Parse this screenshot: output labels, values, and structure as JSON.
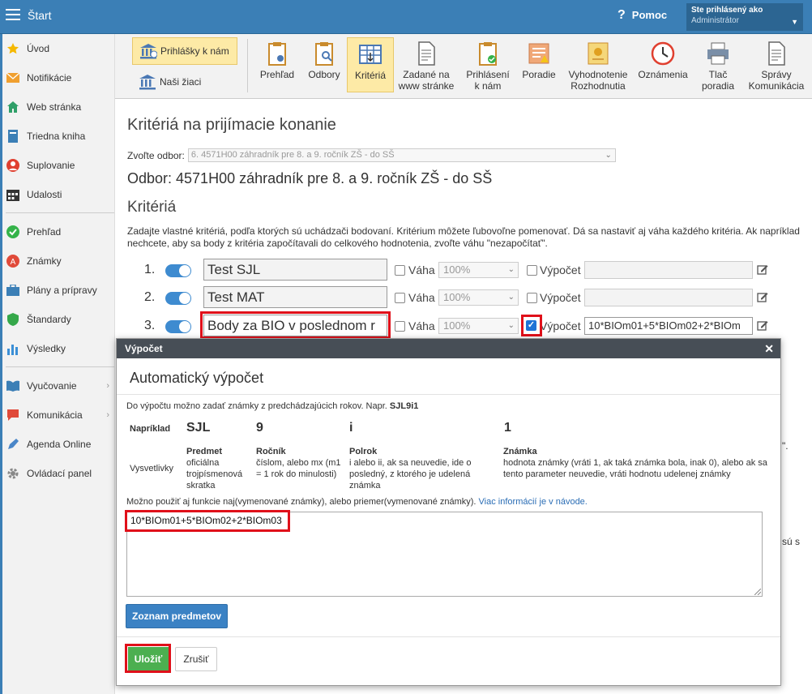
{
  "topbar": {
    "brand": "Štart",
    "help": "Pomoc",
    "user_line1": "Ste prihlásený ako",
    "user_line2": "Administrátor"
  },
  "sidebar": {
    "items": [
      {
        "label": "Úvod",
        "icon": "star-icon",
        "color": "#f5b800"
      },
      {
        "label": "Notifikácie",
        "icon": "envelope-icon",
        "color": "#f0a030"
      },
      {
        "label": "Web stránka",
        "icon": "house-icon",
        "color": "#2f9f68"
      },
      {
        "label": "Triedna kniha",
        "icon": "book-icon",
        "color": "#3b7fb6"
      },
      {
        "label": "Suplovanie",
        "icon": "person-icon",
        "color": "#e04030"
      },
      {
        "label": "Udalosti",
        "icon": "calendar-icon",
        "color": "#333333"
      },
      {
        "label": "Prehľad",
        "icon": "check-circle-icon",
        "color": "#35b34a"
      },
      {
        "label": "Známky",
        "icon": "grade-icon",
        "color": "#e04a3a"
      },
      {
        "label": "Plány a prípravy",
        "icon": "briefcase-icon",
        "color": "#3b7fb6"
      },
      {
        "label": "Štandardy",
        "icon": "shield-icon",
        "color": "#35a84a"
      },
      {
        "label": "Výsledky",
        "icon": "bar-chart-icon",
        "color": "#3b8fd6"
      },
      {
        "label": "Vyučovanie",
        "icon": "book-open-icon",
        "color": "#3b7fb6"
      },
      {
        "label": "Komunikácia",
        "icon": "chat-icon",
        "color": "#e04a3a"
      },
      {
        "label": "Agenda Online",
        "icon": "pen-icon",
        "color": "#4a86c8"
      },
      {
        "label": "Ovládací panel",
        "icon": "gear-icon",
        "color": "#888888"
      }
    ]
  },
  "toolbar": {
    "prihlasky": "Prihlášky k nám",
    "ziaci": "Naši žiaci",
    "buttons": [
      {
        "l1": "Prehľad",
        "l2": ""
      },
      {
        "l1": "Odbory",
        "l2": ""
      },
      {
        "l1": "Kritériá",
        "l2": ""
      },
      {
        "l1": "Zadané na",
        "l2": "www stránke"
      },
      {
        "l1": "Prihlásení",
        "l2": "k nám"
      },
      {
        "l1": "Poradie",
        "l2": ""
      },
      {
        "l1": "Vyhodnotenie",
        "l2": "Rozhodnutia"
      },
      {
        "l1": "Oznámenia",
        "l2": ""
      },
      {
        "l1": "Tlač",
        "l2": "poradia"
      },
      {
        "l1": "Správy",
        "l2": "Komunikácia"
      }
    ]
  },
  "main": {
    "title": "Kritériá na prijímacie konanie",
    "select_label": "Zvoľte odbor:",
    "select_value": "6. 4571H00 záhradník pre 8. a 9. ročník ZŠ - do SŠ",
    "odbor": "Odbor: 4571H00 záhradník pre 8. a 9. ročník ZŠ - do SŠ",
    "kriteria_title": "Kritériá",
    "description": "Zadajte vlastné kritériá, podľa ktorých sú uchádzači bodovaní. Kritérium môžete ľubovoľne pomenovať. Dá sa nastaviť aj váha každého kritéria. Ak napríklad nechcete, aby sa body z kritéria započítavali do celkového hodnotenia, zvoľte váhu \"nezapočítať\".",
    "vaha_label": "Váha",
    "vypocet_label": "Výpočet",
    "criteria": [
      {
        "num": "1.",
        "name": "Test SJL",
        "weight": "100%",
        "formula": "",
        "calc": false
      },
      {
        "num": "2.",
        "name": "Test MAT",
        "weight": "100%",
        "formula": "",
        "calc": false
      },
      {
        "num": "3.",
        "name": "Body za BIO v poslednom r",
        "weight": "100%",
        "formula": "10*BIOm01+5*BIOm02+2*BIOm",
        "calc": true
      }
    ],
    "frag_quote": "\".",
    "frag_s": "sú s"
  },
  "modal": {
    "header": "Výpočet",
    "title": "Automatický výpočet",
    "intro": "Do výpočtu možno zadať známky z predchádzajúcich rokov. Napr.",
    "intro_example": "SJL9i1",
    "example_label": "Napríklad",
    "explain_label": "Vysvetlivky",
    "columns": [
      {
        "value": "SJL",
        "head": "Predmet",
        "desc": "oficiálna trojpísmenová skratka"
      },
      {
        "value": "9",
        "head": "Ročník",
        "desc": "číslom, alebo mx (m1 = 1 rok do minulosti)"
      },
      {
        "value": "i",
        "head": "Polrok",
        "desc": "i alebo ii, ak sa neuvedie, ide o posledný, z ktorého je udelená známka"
      },
      {
        "value": "1",
        "head": "Známka",
        "desc": "hodnota známky (vráti 1, ak taká známka bola, inak 0), alebo ak sa tento parameter neuvedie, vráti hodnotu udelenej známky"
      }
    ],
    "functions_text": "Možno použiť aj funkcie naj(vymenované známky), alebo priemer(vymenované známky).",
    "functions_link": "Viac informácií je v návode.",
    "formula": "10*BIOm01+5*BIOm02+2*BIOm03",
    "list_button": "Zoznam predmetov",
    "save_button": "Uložiť",
    "cancel_button": "Zrušiť"
  }
}
